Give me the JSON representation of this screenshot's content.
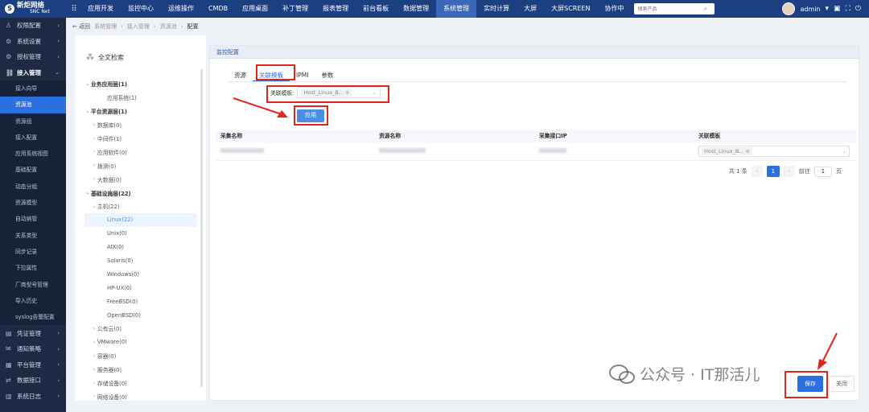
{
  "topbar": {
    "logo_title": "新炬网络",
    "logo_sub": "SNC Net",
    "nav": [
      "应用开发",
      "监控中心",
      "运维操作",
      "CMDB",
      "应用桌面",
      "补丁管理",
      "报表管理",
      "前台看板",
      "数据管理",
      "系统管理",
      "实时计算",
      "大屏",
      "大屏SCREEN",
      "协作中"
    ],
    "active_nav": "系统管理",
    "search_placeholder": "搜索产品",
    "user": "admin"
  },
  "sidebar": {
    "top_items": [
      {
        "label": "权限配置",
        "icon": "person-icon"
      },
      {
        "label": "系统设置",
        "icon": "gear-icon"
      },
      {
        "label": "授权管理",
        "icon": "gear-icon"
      },
      {
        "label": "接入管理",
        "icon": "link-icon"
      }
    ],
    "sub_items": [
      "接入向导",
      "资源池",
      "资源组",
      "接入配置",
      "应用系统视图",
      "基础配置",
      "动态分组",
      "资源模型",
      "自动纳管",
      "关系类型",
      "同步记录",
      "下拉属性",
      "厂商型号管理",
      "导入历史",
      "syslog告警配置"
    ],
    "active_sub": "资源池",
    "bottom_items": [
      {
        "label": "凭证管理",
        "icon": "card-icon"
      },
      {
        "label": "通知策略",
        "icon": "message-icon"
      },
      {
        "label": "平台管理",
        "icon": "grid-icon"
      },
      {
        "label": "数据接口",
        "icon": "api-icon"
      },
      {
        "label": "系统日志",
        "icon": "doc-icon"
      }
    ]
  },
  "breadcrumb": {
    "back": "返回",
    "items": [
      "系统管理",
      "接入管理",
      "资源池"
    ],
    "current": "配置"
  },
  "tree": {
    "title": "全文检索",
    "nodes": [
      {
        "label": "业务应用层(1)",
        "level": 0,
        "toggle": "⌄"
      },
      {
        "label": "应用系统(1)",
        "level": 2,
        "toggle": ""
      },
      {
        "label": "平台资源层(1)",
        "level": 0,
        "toggle": "⌄"
      },
      {
        "label": "数据库(0)",
        "level": 1,
        "toggle": "›"
      },
      {
        "label": "中间件(1)",
        "level": 1,
        "toggle": "›"
      },
      {
        "label": "应用软件(0)",
        "level": 1,
        "toggle": "›"
      },
      {
        "label": "拨测(0)",
        "level": 1,
        "toggle": "›"
      },
      {
        "label": "大数据(0)",
        "level": 1,
        "toggle": "›"
      },
      {
        "label": "基础设施层(22)",
        "level": 0,
        "toggle": "⌄"
      },
      {
        "label": "主机(22)",
        "level": 1,
        "toggle": "⌄"
      },
      {
        "label": "Linux(22)",
        "level": 2,
        "toggle": "",
        "selected": true
      },
      {
        "label": "Unix(0)",
        "level": 2,
        "toggle": ""
      },
      {
        "label": "AIX(0)",
        "level": 2,
        "toggle": ""
      },
      {
        "label": "Solaris(0)",
        "level": 2,
        "toggle": ""
      },
      {
        "label": "Windows(0)",
        "level": 2,
        "toggle": ""
      },
      {
        "label": "HP-UX(0)",
        "level": 2,
        "toggle": ""
      },
      {
        "label": "FreeBSD(0)",
        "level": 2,
        "toggle": ""
      },
      {
        "label": "OpenBSD(0)",
        "level": 2,
        "toggle": ""
      },
      {
        "label": "公有云(0)",
        "level": 1,
        "toggle": "›"
      },
      {
        "label": "VMware(0)",
        "level": 1,
        "toggle": "›"
      },
      {
        "label": "容器(0)",
        "level": 1,
        "toggle": "›"
      },
      {
        "label": "服务器(0)",
        "level": 1,
        "toggle": "›"
      },
      {
        "label": "存储设备(0)",
        "level": 1,
        "toggle": "›"
      },
      {
        "label": "网络设备(0)",
        "level": 1,
        "toggle": "›"
      }
    ]
  },
  "main": {
    "header": "监控配置",
    "tabs": [
      "资源",
      "关联模板",
      "IPMI",
      "参数"
    ],
    "active_tab": "关联模板",
    "assoc_label": "关联模板:",
    "assoc_value": "Host_Linux_B...",
    "apply": "应用",
    "columns": [
      "采集名称",
      "资源名称",
      "采集接口IP",
      "关联模板"
    ],
    "row_template": "Host_Linux_B...",
    "pager": {
      "total": "共 1 条",
      "page": "1",
      "goto": "前往",
      "page_input": "1",
      "page_unit": "页"
    },
    "save": "保存",
    "close": "关闭"
  },
  "watermark": "公众号 · IT那活儿",
  "colors": {
    "topbar": "#1c3f82",
    "sidebar": "#1e2a44",
    "accent": "#2c6fe0",
    "highlight": "#e0251f"
  }
}
